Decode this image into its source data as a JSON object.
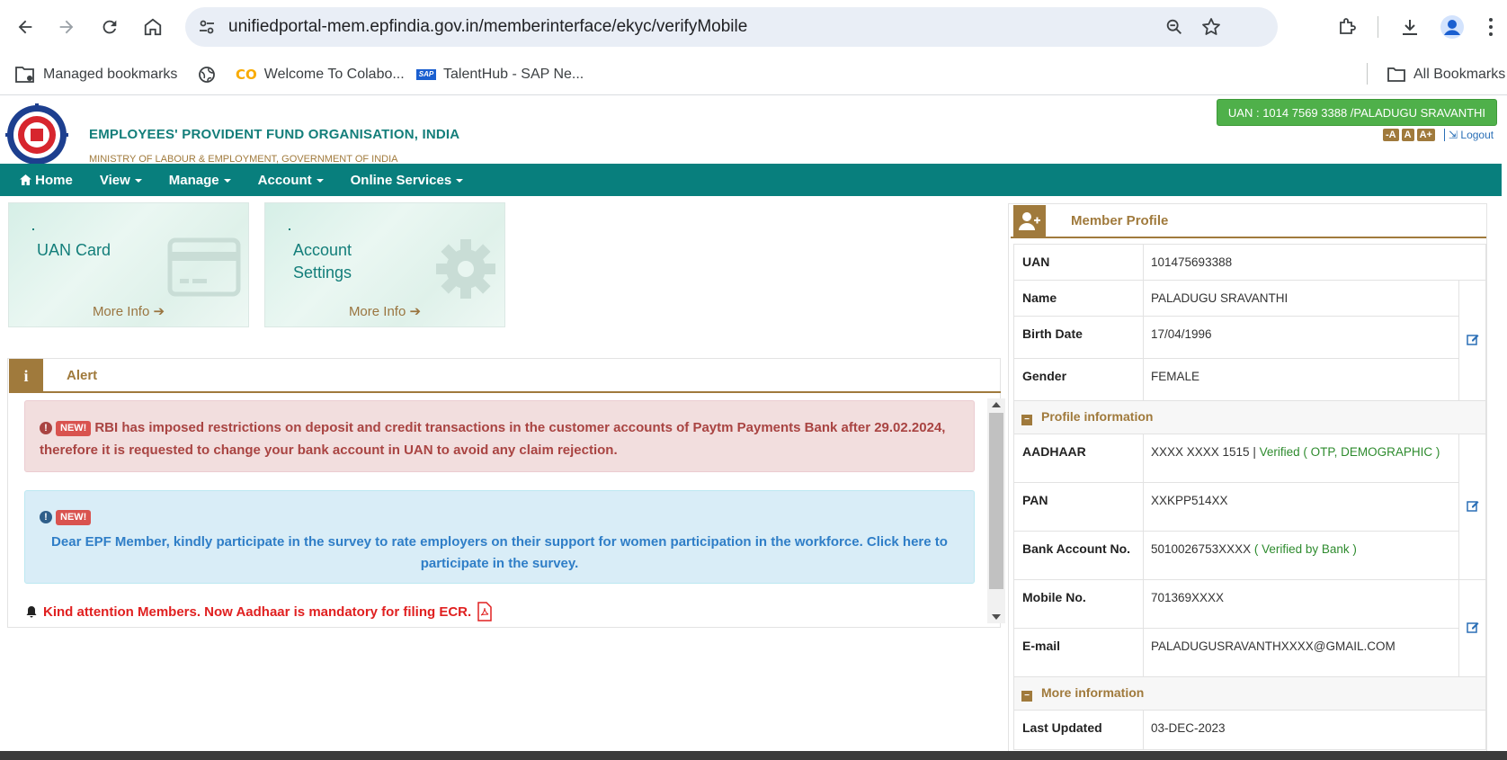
{
  "browser": {
    "url": "unifiedportal-mem.epfindia.gov.in/memberinterface/ekyc/verifyMobile",
    "bookmarks": [
      "Managed bookmarks",
      "Welcome To Colabo...",
      "TalentHub - SAP Ne..."
    ],
    "all_bookmarks": "All Bookmarks"
  },
  "header": {
    "org_title": "EMPLOYEES' PROVIDENT FUND ORGANISATION, INDIA",
    "ministry": "MINISTRY OF LABOUR & EMPLOYMENT, GOVERNMENT OF INDIA",
    "uan_badge": "UAN : 1014 7569 3388 /PALADUGU SRAVANTHI",
    "font_buttons": [
      "-A",
      "A",
      "A+"
    ],
    "logout": "Logout"
  },
  "nav": {
    "home": "Home",
    "view": "View",
    "manage": "Manage",
    "account": "Account",
    "online_services": "Online Services"
  },
  "cards": [
    {
      "title": "UAN Card",
      "more": "More Info"
    },
    {
      "title_line1": "Account",
      "title_line2": "Settings",
      "more": "More Info"
    }
  ],
  "alert": {
    "title": "Alert",
    "new_badge": "NEW!",
    "red_line1": "RBI has imposed restrictions on deposit and credit transactions in the customer accounts of Paytm Payments Bank after 29.02.2024,",
    "red_line2": "therefore it is requested to change your bank account in UAN to avoid any claim rejection.",
    "blue_line1": "Dear EPF Member, kindly participate in the survey to rate employers on their support for women participation in the workforce. Click here to",
    "blue_line2": "participate in the survey.",
    "attention": "Kind attention Members. Now Aadhaar is mandatory for filing ECR."
  },
  "profile": {
    "title": "Member Profile",
    "uan_label": "UAN",
    "uan": "101475693388",
    "name_label": "Name",
    "name": "PALADUGU SRAVANTHI",
    "birth_label": "Birth Date",
    "birth": "17/04/1996",
    "gender_label": "Gender",
    "gender": "FEMALE",
    "profile_info": "Profile information",
    "aadhaar_label": "AADHAAR",
    "aadhaar": "XXXX XXXX 1515 |",
    "aadhaar_status": "Verified ( OTP, DEMOGRAPHIC )",
    "pan_label": "PAN",
    "pan": "XXKPP514XX",
    "bank_label": "Bank Account No.",
    "bank": "5010026753XXXX",
    "bank_status": "( Verified by Bank )",
    "mobile_label": "Mobile No.",
    "mobile": "701369XXXX",
    "email_label": "E-mail",
    "email": "PALADUGUSRAVANTHXXXX@GMAIL.COM",
    "more_info": "More information",
    "updated_label": "Last Updated",
    "updated": "03-DEC-2023"
  },
  "colors": {
    "teal": "#087f7d",
    "gold": "#a07a3c",
    "green_badge": "#4fb04a"
  }
}
